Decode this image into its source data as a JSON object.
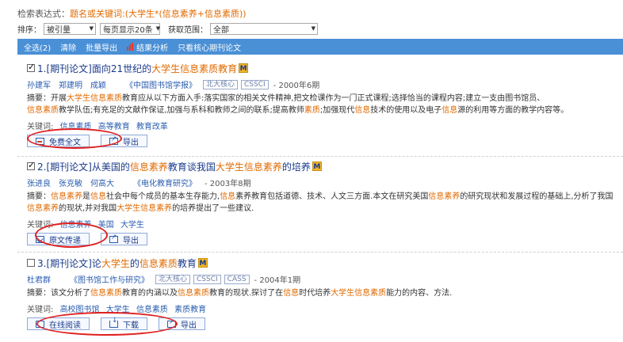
{
  "search": {
    "label": "检索表达式：",
    "expression": "题名或关键词:(大学生*(信息素养+信息素质))"
  },
  "options": {
    "sort_label": "排序：",
    "sort_value": "被引量",
    "per_page_value": "每页显示20条",
    "range_label": "获取范围：",
    "range_value": "全部"
  },
  "toolbar": {
    "select_all": "全选(2)",
    "clear": "清除",
    "batch_export": "批量导出",
    "analysis": "结果分析",
    "core_only": "只看核心期刊论文"
  },
  "colors": {
    "toolbar_bg": "#4a90d6",
    "highlight": "#e06a00",
    "link": "#2a5db0",
    "annotation_circle": "#e02020"
  },
  "records": [
    {
      "checked": true,
      "title_parts": [
        "1.[期刊论文]面向21世纪的",
        "大学生信息素质教育"
      ],
      "authors": [
        "孙建军",
        "郑建明",
        "成颖"
      ],
      "journal": "《中国图书馆学报》",
      "tags": [
        "北大核心",
        "CSSCI"
      ],
      "year": "- 2000年6期",
      "abstract_prefix": "摘要：开展",
      "abstract_hl1": "大学生信息素质",
      "abstract_mid": "教育应从以下方面入手:落实国家的相关文件精神,把文检课作为一门正式课程;选择恰当的课程内容;建立一支由图书馆员、",
      "abstract_hl2": "信息素质",
      "abstract_mid2": "教学队伍;有充足的文献作保证,加强与系科和教师之间的联系;提高教师",
      "abstract_hl3": "素质",
      "abstract_mid3": ";加强现代",
      "abstract_hl4": "信息",
      "abstract_mid4": "技术的使用以及电子",
      "abstract_hl5": "信息",
      "abstract_end": "源的利用等方面的教学内容等。",
      "kw_label": "关键词:",
      "keywords": [
        "信息素质",
        "高等教育",
        "教育改革"
      ],
      "buttons": [
        "免费全文",
        "导出"
      ]
    },
    {
      "checked": true,
      "title_parts": [
        "2.[期刊论文]从美国的",
        "信息素养",
        "教育谈我国",
        "大学生信息素养",
        "的培养"
      ],
      "authors": [
        "张进良",
        "张克敏",
        "何高大"
      ],
      "journal": "《电化教育研究》",
      "year": "- 2003年8期",
      "abstract_prefix": "摘要：",
      "abstract_hl1": "信息素养",
      "abstract_mid": "是",
      "abstract_hl2": "信息",
      "abstract_mid2": "社会中每个成员的基本生存能力,",
      "abstract_hl3": "信息",
      "abstract_mid3": "素养教育包括道德、技术、人文三方面.本文在研究美国",
      "abstract_hl4": "信息素养",
      "abstract_mid4": "的研究现状和发展过程的基础上,分析了我国",
      "abstract_line2_hl": "信息素养",
      "abstract_line2_mid": "的现状,并对我国",
      "abstract_line2_hl2": "大学生信息素养",
      "abstract_line2_end": "的培养提出了一些建议.",
      "kw_label": "关键词:",
      "keywords": [
        "信息素养",
        "美国",
        "大学生"
      ],
      "buttons": [
        "原文传递",
        "导出"
      ]
    },
    {
      "checked": false,
      "title_parts": [
        "3.[期刊论文]论",
        "大学生",
        "的",
        "信息素质",
        "教育"
      ],
      "authors": [
        "杜君群"
      ],
      "journal": "《图书馆工作与研究》",
      "tags": [
        "北大核心",
        "CSSCI",
        "CASS"
      ],
      "year": "- 2004年1期",
      "abstract_prefix": "摘要：该文分析了",
      "abstract_hl1": "信息素质",
      "abstract_mid": "教育的内涵以及",
      "abstract_hl2": "信息素质",
      "abstract_mid2": "教育的现状.探讨了在",
      "abstract_hl3": "信息",
      "abstract_mid3": "时代培养",
      "abstract_hl4": "大学生信息素质",
      "abstract_end": "能力的内容、方法.",
      "kw_label": "关键词:",
      "keywords": [
        "高校图书馆",
        "大学生",
        "信息素质",
        "素质教育"
      ],
      "buttons": [
        "在线阅读",
        "下载",
        "导出"
      ]
    }
  ],
  "badge_letter": "M"
}
